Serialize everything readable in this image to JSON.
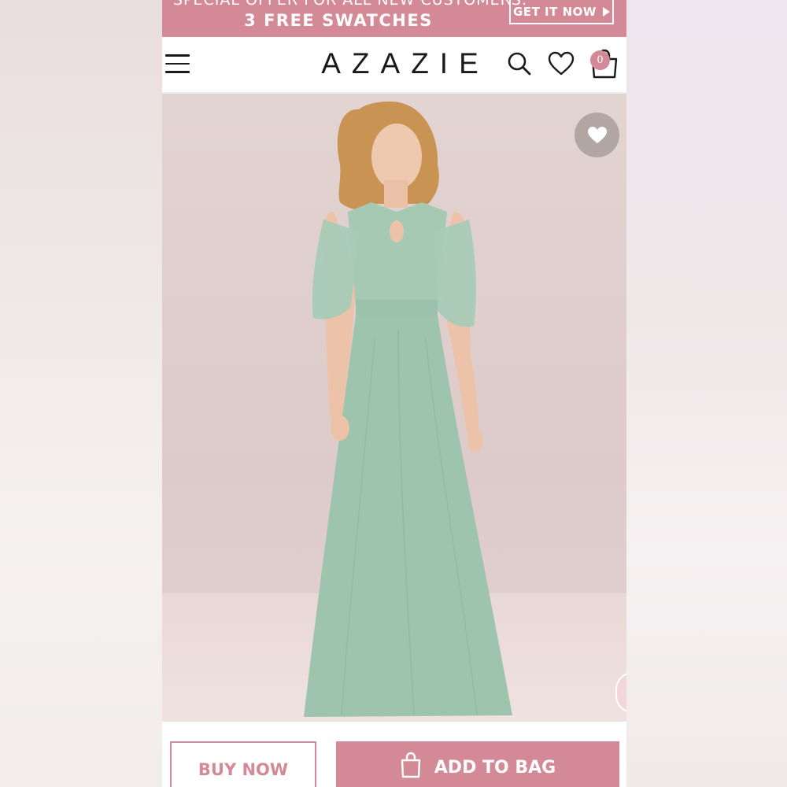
{
  "promo": {
    "line1": "SPECIAL OFFER FOR ALL NEW CUSTOMERS:",
    "line2": "3 FREE SWATCHES",
    "cta_label": "GET IT NOW"
  },
  "header": {
    "logo": "AZAZIE",
    "cart_count": "0",
    "icons": [
      "menu-icon",
      "search-icon",
      "heart-icon",
      "shopping-bag-icon"
    ]
  },
  "product": {
    "image_alt": "Model wearing a long sage green chiffon dress with cold-shoulder flutter sleeves and keyhole halter neckline",
    "dress_color": "#9fc4ad",
    "favorite_icon": "heart-icon"
  },
  "actions": {
    "buy_now_label": "BUY NOW",
    "add_to_bag_label": "ADD TO BAG",
    "add_to_bag_icon": "shopping-bag-icon"
  },
  "colors": {
    "brand": "#d38a96",
    "text": "#1a1a1a"
  }
}
